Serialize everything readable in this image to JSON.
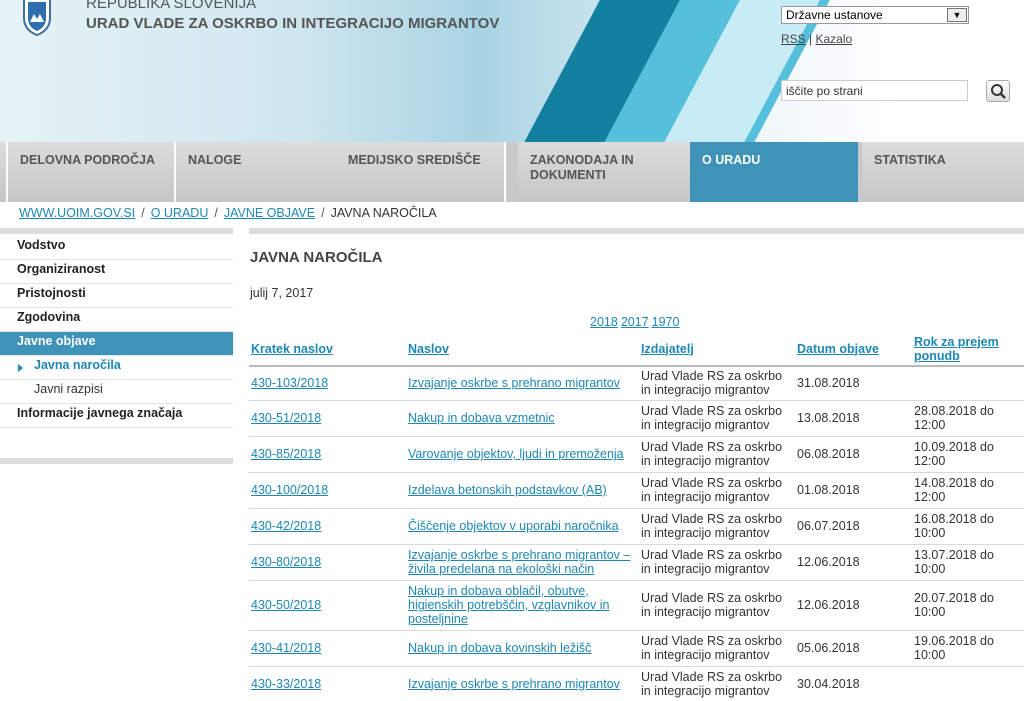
{
  "header": {
    "republic": "REPUBLIKA SLOVENIJA",
    "office": "URAD VLADE ZA OSKRBO IN INTEGRACIJO MIGRANTOV",
    "institutions_select": "Državne ustanove",
    "links": [
      "RSS",
      "Kazalo"
    ],
    "search_placeholder": "iščite po strani"
  },
  "nav": [
    {
      "label": "DELOVNA PODROČJA"
    },
    {
      "label": "NALOGE"
    },
    {
      "label": "MEDIJSKO SREDIŠČE"
    },
    {
      "label": "ZAKONODAJA IN DOKUMENTI"
    },
    {
      "label": "O URADU"
    },
    {
      "label": "STATISTIKA"
    }
  ],
  "breadcrumb": [
    "WWW.UOIM.GOV.SI",
    "O URADU",
    "JAVNE OBJAVE",
    "JAVNA NAROČILA"
  ],
  "sidebar": [
    "Vodstvo",
    "Organiziranost",
    "Pristojnosti",
    "Zgodovina",
    "Javne objave",
    "Javna naročila",
    "Javni razpisi",
    "Informacije javnega značaja"
  ],
  "main": {
    "title": "JAVNA NAROČILA",
    "date": "julij 7, 2017",
    "years": [
      "2018",
      "2017",
      "1970"
    ]
  },
  "table": {
    "headers": [
      "Kratek naslov",
      "Naslov",
      "Izdajatelj",
      "Datum objave",
      "Rok za prejem ponudb"
    ],
    "rows": [
      [
        "430-103/2018",
        "Izvajanje oskrbe s prehrano migrantov",
        "Urad Vlade RS za oskrbo in integracijo migrantov",
        "31.08.2018",
        ""
      ],
      [
        "430-51/2018",
        "Nakup in dobava vzmetnic",
        "Urad Vlade RS za oskrbo in integracijo migrantov",
        "13.08.2018",
        "28.08.2018 do 12:00"
      ],
      [
        "430-85/2018",
        "Varovanje objektov, ljudi in premoženja",
        "Urad Vlade RS za oskrbo in integracijo migrantov",
        "06.08.2018",
        "10.09.2018 do 12:00"
      ],
      [
        "430-100/2018",
        "Izdelava betonskih podstavkov (AB)",
        "Urad Vlade RS za oskrbo in integracijo migrantov",
        "01.08.2018",
        "14.08.2018 do 12:00"
      ],
      [
        "430-42/2018",
        "Čiščenje objektov v uporabi naročnika",
        "Urad Vlade RS za oskrbo in integracijo migrantov",
        "06.07.2018",
        "16.08.2018 do 10:00"
      ],
      [
        "430-80/2018",
        "Izvajanje oskrbe s prehrano migrantov – živila predelana na ekološki način",
        "Urad Vlade RS za oskrbo in integracijo migrantov",
        "12.06.2018",
        "13.07.2018 do 10:00"
      ],
      [
        "430-50/2018",
        "Nakup in dobava oblačil, obutve, higienskih potrebščin, vzglavnikov in posteljnine",
        "Urad Vlade RS za oskrbo in integracijo migrantov",
        "12.06.2018",
        "20.07.2018 do 10:00"
      ],
      [
        "430-41/2018",
        "Nakup in dobava kovinskih ležišč",
        "Urad Vlade RS za oskrbo in integracijo migrantov",
        "05.06.2018",
        "19.06.2018 do 10:00"
      ],
      [
        "430-33/2018",
        "Izvajanje oskrbe s prehrano migrantov",
        "Urad Vlade RS za oskrbo in integracijo migrantov",
        "30.04.2018",
        ""
      ]
    ]
  },
  "colors": {
    "accent": "#3f93b8",
    "link": "#1e87b4"
  }
}
